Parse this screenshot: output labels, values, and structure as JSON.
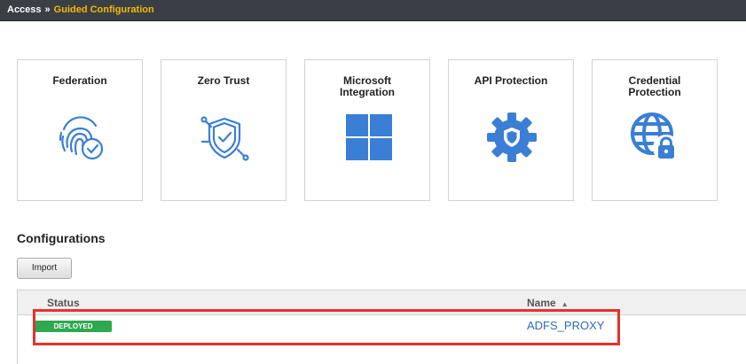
{
  "breadcrumb": {
    "root": "Access",
    "separator": "»",
    "current": "Guided Configuration"
  },
  "tiles": [
    {
      "title": "Federation",
      "icon": "fingerprint-check-icon"
    },
    {
      "title": "Zero Trust",
      "icon": "shield-check-icon"
    },
    {
      "title": "Microsoft\nIntegration",
      "icon": "windows-logo-icon"
    },
    {
      "title": "API Protection",
      "icon": "gear-shield-icon"
    },
    {
      "title": "Credential\nProtection",
      "icon": "globe-lock-icon"
    }
  ],
  "colors": {
    "icon": "#3a7fd5",
    "accent": "#f5b800",
    "deployed": "#2fa84f",
    "link": "#2a6eb8",
    "highlight": "#e8312a"
  },
  "configurations": {
    "title": "Configurations",
    "import_label": "Import",
    "columns": {
      "status": "Status",
      "name": "Name"
    },
    "sort": {
      "column": "name",
      "direction": "ascending"
    },
    "rows": [
      {
        "status": "DEPLOYED",
        "name": "ADFS_PROXY"
      }
    ]
  }
}
